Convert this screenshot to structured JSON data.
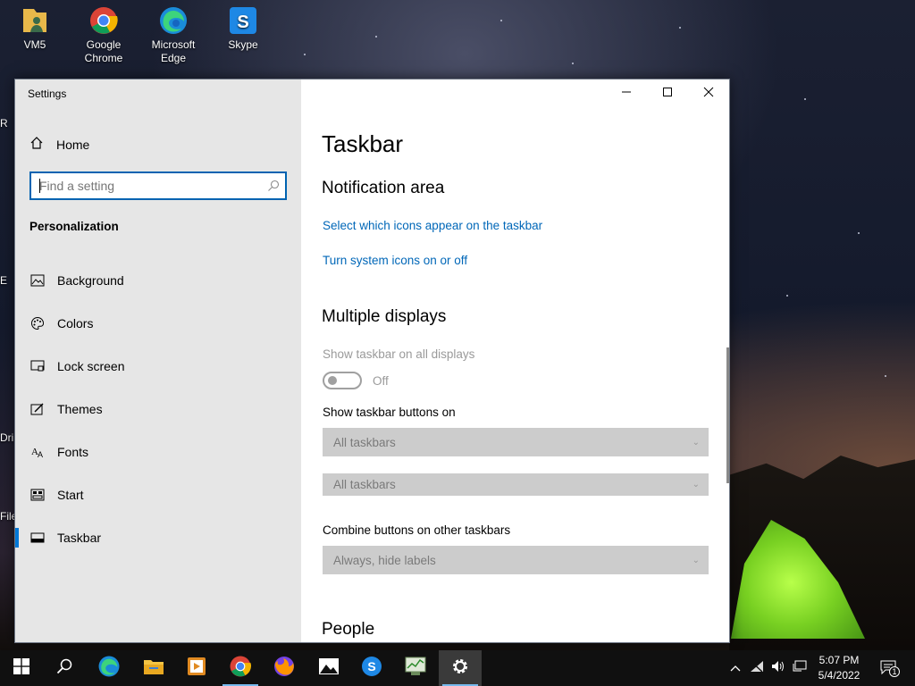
{
  "desktop": {
    "icons": [
      {
        "label": "VM5",
        "icon": "user-folder-icon"
      },
      {
        "label": "Google Chrome",
        "icon": "chrome-icon"
      },
      {
        "label": "Microsoft Edge",
        "icon": "edge-icon"
      },
      {
        "label": "Skype",
        "icon": "skype-icon"
      }
    ],
    "partial_labels": [
      "R",
      "E",
      "Dri",
      "File"
    ]
  },
  "window": {
    "title": "Settings",
    "sidebar": {
      "home_label": "Home",
      "search_placeholder": "Find a setting",
      "section": "Personalization",
      "items": [
        {
          "label": "Background",
          "icon": "image-icon"
        },
        {
          "label": "Colors",
          "icon": "palette-icon"
        },
        {
          "label": "Lock screen",
          "icon": "lock-screen-icon"
        },
        {
          "label": "Themes",
          "icon": "themes-icon"
        },
        {
          "label": "Fonts",
          "icon": "fonts-icon"
        },
        {
          "label": "Start",
          "icon": "start-icon"
        },
        {
          "label": "Taskbar",
          "icon": "taskbar-icon",
          "active": true
        }
      ]
    },
    "content": {
      "page_title": "Taskbar",
      "notification_area": {
        "heading": "Notification area",
        "link_icons": "Select which icons appear on the taskbar",
        "link_system_icons": "Turn system icons on or off"
      },
      "multiple_displays": {
        "heading": "Multiple displays",
        "show_all_label": "Show taskbar on all displays",
        "toggle_state": "Off",
        "buttons_on_label": "Show taskbar buttons on",
        "buttons_on_value": "All taskbars",
        "buttons_on_value_2": "All taskbars",
        "combine_label": "Combine buttons on other taskbars",
        "combine_value": "Always, hide labels"
      },
      "people_heading": "People"
    }
  },
  "taskbar": {
    "apps": [
      {
        "name": "start-button",
        "icon": "windows-logo-icon"
      },
      {
        "name": "search-button",
        "icon": "search-icon"
      },
      {
        "name": "edge",
        "icon": "edge-icon"
      },
      {
        "name": "file-explorer",
        "icon": "folder-icon"
      },
      {
        "name": "media-player",
        "icon": "media-player-icon"
      },
      {
        "name": "chrome",
        "icon": "chrome-icon",
        "running": true
      },
      {
        "name": "firefox",
        "icon": "firefox-icon"
      },
      {
        "name": "photos",
        "icon": "photos-icon"
      },
      {
        "name": "skype",
        "icon": "skype-icon"
      },
      {
        "name": "task-manager",
        "icon": "task-manager-icon"
      },
      {
        "name": "settings",
        "icon": "gear-icon",
        "active": true
      }
    ],
    "clock_time": "5:07 PM",
    "clock_date": "5/4/2022",
    "notification_count": "1"
  },
  "colors": {
    "accent": "#0078d7",
    "link": "#0067b8",
    "sidebar_bg": "#e6e6e6",
    "taskbar_bg": "#101010"
  }
}
